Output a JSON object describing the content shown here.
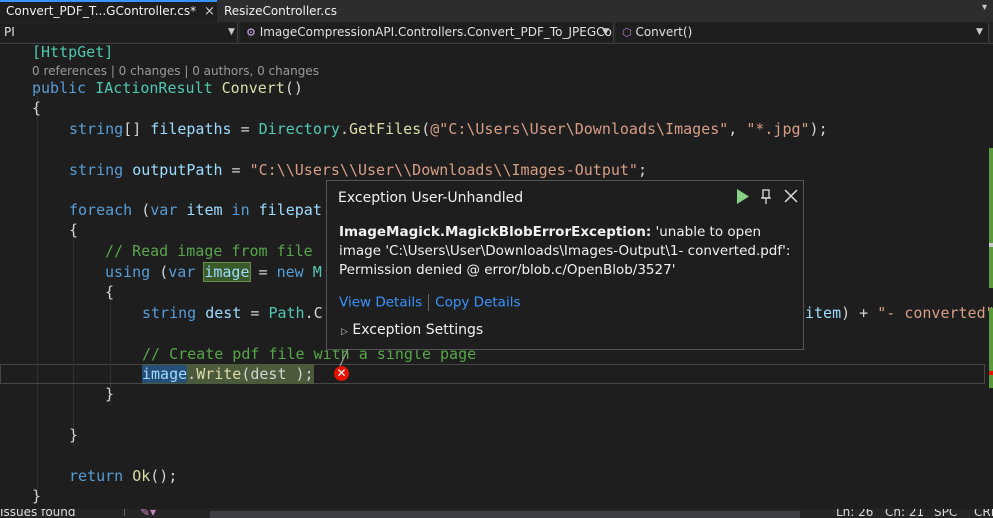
{
  "tabs": [
    {
      "label": "Convert_PDF_T...GController.cs*",
      "close": "⊗",
      "active": true
    },
    {
      "label": "ResizeController.cs",
      "close": "",
      "active": false
    }
  ],
  "tab_close_glyph": "×",
  "navbar": {
    "project": "PI",
    "class": "ImageCompressionAPI.Controllers.Convert_PDF_To_JPEGContro",
    "member": "Convert()",
    "member_icon": "method-cube-icon"
  },
  "code": {
    "line1": {
      "attr": "[HttpGet]"
    },
    "codelens": "0 references | 0 changes | 0 authors, 0 changes",
    "line2": {
      "kw": "public ",
      "ty": "IActionResult ",
      "mt": "Convert",
      "p": "()"
    },
    "line3": "{",
    "line4": {
      "kw": "string",
      "p1": "[] ",
      "vr": "filepaths",
      "p2": " = ",
      "ty": "Directory",
      "p3": ".",
      "mt": "GetFiles",
      "p4": "(",
      "s1": "@\"C:\\Users\\User\\Downloads\\Images\"",
      "p5": ", ",
      "s2": "\"*.jpg\"",
      "p6": ");"
    },
    "line5": {
      "kw": "string ",
      "vr": "outputPath",
      "p1": " = ",
      "s": "\"C:\\\\Users\\\\User\\\\Downloads\\\\Images-Output\"",
      "p2": ";"
    },
    "line6": {
      "kw1": "foreach ",
      "p1": "(",
      "kw2": "var ",
      "vr": "item",
      "kw3": " in ",
      "vr2": "filepat"
    },
    "line7": "{",
    "line8": "// Read image from file",
    "line9": {
      "kw": "using ",
      "p1": "(",
      "kw2": "var ",
      "vr": "image",
      "p2": " = ",
      "kw3": "new ",
      "ty": "M"
    },
    "line10": "{",
    "line11": {
      "kw": "string ",
      "vr": "dest",
      "p1": " = ",
      "ty": "Path",
      "p2": ".C",
      "tail_vr": "item",
      "tail_p": ") + ",
      "tail_s": "\"- converted\""
    },
    "line12": "// Create pdf file with a single page",
    "line13": {
      "vr": "image",
      "p1": ".",
      "mt": "Write",
      "p2": "(dest );"
    },
    "line14": "}",
    "line15": "}",
    "line16": {
      "kw": "return ",
      "mt": "Ok",
      "p": "();"
    },
    "line17": "}"
  },
  "exception": {
    "title": "Exception User-Unhandled",
    "type": "ImageMagick.MagickBlobErrorException:",
    "message": " 'unable to open image 'C:\\Users\\User\\Downloads\\Images-Output\\1- converted.pdf': Permission denied @ error/blob.c/OpenBlob/3527'",
    "view_details": "View Details",
    "copy_details": "Copy Details",
    "settings": "Exception Settings",
    "colors": {
      "continue": "#89d185",
      "link": "#3794ff"
    }
  },
  "status": {
    "issues": "Issues found",
    "ln": "Ln: 26",
    "ch": "Ch: 21",
    "spc": "SPC",
    "crlf": "CRLF"
  },
  "colors": {
    "background": "#1e1e1e",
    "keyword": "#569cd6",
    "type": "#4ec9b0",
    "string": "#d69d85",
    "comment": "#57a64a",
    "error": "#e51400"
  }
}
